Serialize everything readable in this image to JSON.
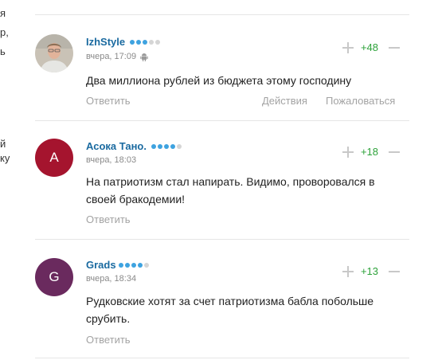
{
  "left_fragment": [
    "я",
    "р,",
    "ь",
    "й",
    "ку"
  ],
  "comments": [
    {
      "username": "IzhStyle",
      "rating_dots": [
        true,
        true,
        true,
        false,
        false
      ],
      "time": "вчера, 17:09",
      "device_icon": "android-icon",
      "avatar": {
        "type": "photo"
      },
      "text": "Два миллиона рублей из бюджета этому господину",
      "score": "+48",
      "reply": "Ответить",
      "actions": "Действия",
      "complain": "Пожаловаться"
    },
    {
      "username": "Асока Тано.",
      "rating_dots": [
        true,
        true,
        true,
        true,
        false
      ],
      "time": "вчера, 18:03",
      "avatar": {
        "type": "letter",
        "letter": "A",
        "color": "#a5142e"
      },
      "text": "На патриотизм стал напирать. Видимо, проворовался в своей бракодемии!",
      "score": "+18",
      "reply": "Ответить"
    },
    {
      "username": "Grads",
      "rating_dots": [
        true,
        true,
        true,
        true,
        false
      ],
      "time": "вчера, 18:34",
      "avatar": {
        "type": "letter",
        "letter": "G",
        "color": "#6a2a5e"
      },
      "text": "Рудковские хотят за счет патриотизма бабла побольше срубить.",
      "score": "+13",
      "reply": "Ответить"
    }
  ],
  "colors": {
    "username": "#1a6aa0",
    "score": "#2da23a",
    "muted": "#a3a3a3",
    "dot_on": "#3ea3e0"
  }
}
